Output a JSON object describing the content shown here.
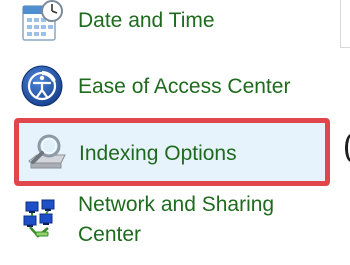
{
  "control_panel": {
    "items": [
      {
        "label": "Date and Time",
        "icon": "calendar-clock-icon"
      },
      {
        "label": "Ease of Access Center",
        "icon": "ease-of-access-icon"
      },
      {
        "label": "Indexing Options",
        "icon": "magnifier-drive-icon",
        "highlighted": true
      },
      {
        "label": "Network and Sharing Center",
        "icon": "network-sharing-icon"
      }
    ]
  },
  "colors": {
    "link_text": "#1e6b1e",
    "highlight_border": "#e0464c",
    "highlight_background": "#e6f2fc"
  }
}
